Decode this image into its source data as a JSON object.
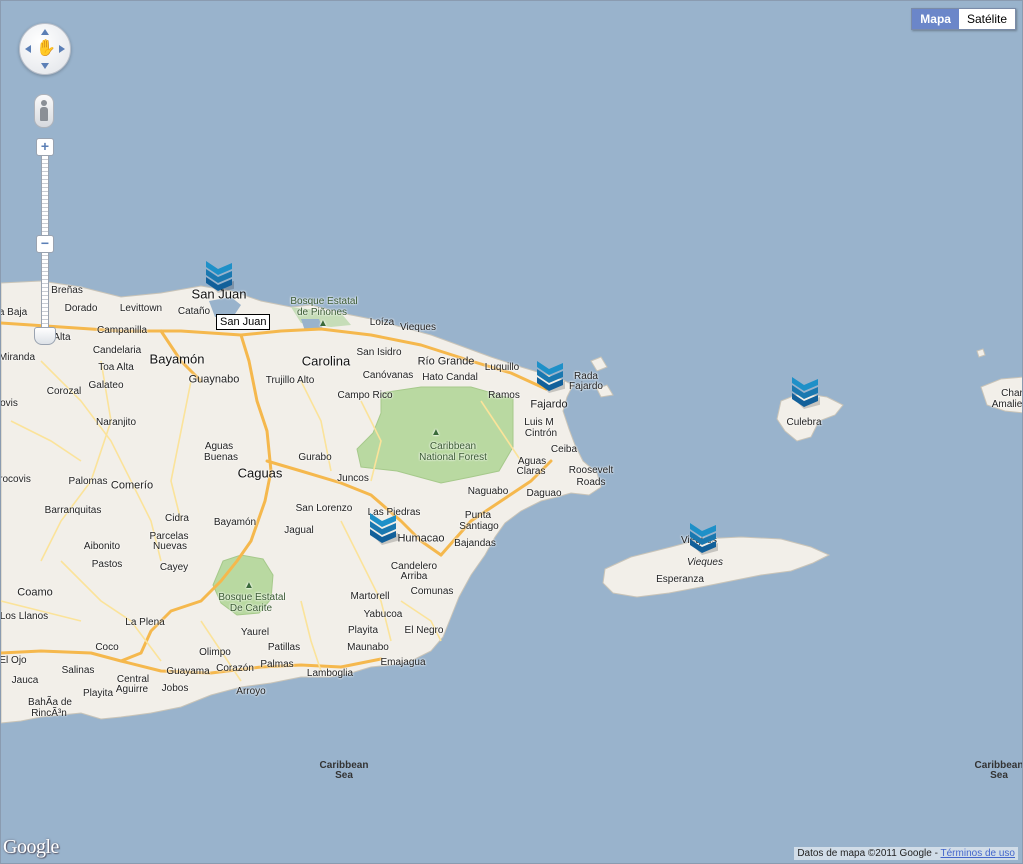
{
  "map_type": {
    "map_label": "Mapa",
    "satellite_label": "Satélite",
    "active": "map"
  },
  "controls": {
    "zoom_in": "+",
    "zoom_out": "−",
    "pan_icon": "hand-pan-icon",
    "pegman_icon": "pegman-icon"
  },
  "colors": {
    "water": "#99b3cc",
    "land": "#f2efe9",
    "forest": "#b9d9a1",
    "highway": "#f5b84d",
    "road": "#fbe39a"
  },
  "tooltip": "San Juan",
  "places": {
    "brenas": "Breñas",
    "dorado": "Dorado",
    "levittown": "Levittown",
    "catano": "Cataño",
    "san_juan": "San Juan",
    "vega_baja": "a Baja",
    "vega_alta": "a Alta",
    "campanilla": "Campanilla",
    "candelaria": "Candelaria",
    "bayamon": "Bayamón",
    "miranda": "Miranda",
    "toa_alta": "Toa Alta",
    "guaynabo": "Guaynabo",
    "trujillo_alto": "Trujillo Alto",
    "carolina": "Carolina",
    "loiza": "Loíza",
    "vieques_town_n": "Vieques",
    "san_isidro": "San Isidro",
    "rio_grande": "Río Grande",
    "luquillo": "Luquillo",
    "canovanas": "Canóvanas",
    "hato_candal": "Hato Candal",
    "rada": "Rada",
    "fajardo_bay": "Fajardo",
    "fajardo": "Fajardo",
    "corozal": "Corozal",
    "galateo": "Galateo",
    "campo_rico": "Campo Rico",
    "ramos": "Ramos",
    "luis_m": "Luis M",
    "cintron": "Cintrón",
    "ovis": "ovis",
    "naranjito": "Naranjito",
    "aguas_buenas_1": "Aguas",
    "aguas_buenas_2": "Buenas",
    "caguas": "Caguas",
    "gurabo": "Gurabo",
    "ceiba": "Ceiba",
    "aguas_claras_1": "Aguas",
    "aguas_claras_2": "Claras",
    "roosevelt_1": "Roosevelt",
    "roosevelt_2": "Roads",
    "orocovis": "rocovis",
    "palomas": "Palomas",
    "comerio": "Comerío",
    "juncos": "Juncos",
    "naguabo": "Naguabo",
    "daguao": "Daguao",
    "barranquitas": "Barranquitas",
    "cidra": "Cidra",
    "bayamon_s": "Bayamón",
    "san_lorenzo": "San Lorenzo",
    "las_piedras": "Las Piedras",
    "punta_santiago_1": "Punta",
    "punta_santiago_2": "Santiago",
    "aibonito": "Aibonito",
    "parcelas_1": "Parcelas",
    "parcelas_2": "Nuevas",
    "jagual": "Jagual",
    "humacao": "Humacao",
    "bajandas": "Bajandas",
    "pastos": "Pastos",
    "cayey": "Cayey",
    "candelero_1": "Candelero",
    "candelero_2": "Arriba",
    "coamo": "Coamo",
    "martorell": "Martorell",
    "comunas": "Comunas",
    "los_llanos": "Los Llanos",
    "la_plena": "La Plena",
    "yaurel": "Yaurel",
    "yabucoa": "Yabucoa",
    "playita_e": "Playita",
    "el_negro": "El Negro",
    "coco": "Coco",
    "olimpo": "Olimpo",
    "patillas": "Patillas",
    "maunabo": "Maunabo",
    "el_ojo": "El Ojo",
    "salinas": "Salinas",
    "guayama": "Guayama",
    "corazon": "Corazón",
    "palmas": "Palmas",
    "lamboglia": "Lamboglia",
    "emajagua": "Emajagua",
    "jauca": "Jauca",
    "central_aguirre_1": "Central",
    "central_aguirre_2": "Aguirre",
    "jobos": "Jobos",
    "arroyo": "Arroyo",
    "playita_s": "Playita",
    "bahia_1": "BahÃa de",
    "bahia_2": "RincÃ³n",
    "culebra": "Culebra",
    "vieques_town": "Vieques",
    "vieques_island": "Vieques",
    "esperanza": "Esperanza",
    "charlotte": "Char",
    "amalie": "Amalie"
  },
  "parks": {
    "pinones_1": "Bosque Estatal",
    "pinones_2": "de Piñones",
    "caribbean_nf_1": "Caribbean",
    "caribbean_nf_2": "National Forest",
    "carite_1": "Bosque Estatal",
    "carite_2": "De Carite"
  },
  "seas": {
    "caribbean_1": "Caribbean Sea",
    "caribbean_2": "Caribbean Sea"
  },
  "markers": [
    "San Juan",
    "Fajardo",
    "Culebra",
    "Humacao",
    "Vieques"
  ],
  "footer": {
    "logo": "Google",
    "attribution": "Datos de mapa ©2011 Google - ",
    "terms": "Términos de uso"
  }
}
